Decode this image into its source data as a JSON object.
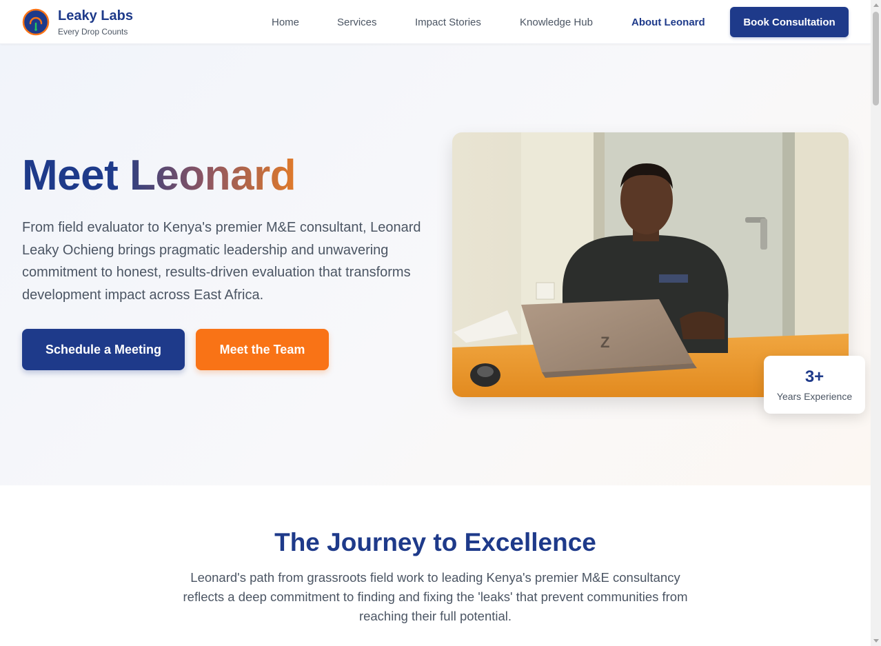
{
  "header": {
    "brand_name": "Leaky Labs",
    "brand_tagline": "Every Drop Counts",
    "nav": [
      {
        "label": "Home"
      },
      {
        "label": "Services"
      },
      {
        "label": "Impact Stories"
      },
      {
        "label": "Knowledge Hub"
      },
      {
        "label": "About Leonard",
        "active": true
      }
    ],
    "cta_label": "Book Consultation"
  },
  "hero": {
    "title_part1": "Meet",
    "title_part2": "Leonard",
    "description": "From field evaluator to Kenya's premier M&E consultant, Leonard Leaky Ochieng brings pragmatic leadership and unwavering commitment to honest, results-driven evaluation that transforms development impact across East Africa.",
    "primary_button": "Schedule a Meeting",
    "secondary_button": "Meet the Team",
    "stat_value": "3+",
    "stat_label": "Years Experience"
  },
  "journey": {
    "title": "The Journey to Excellence",
    "description": "Leonard's path from grassroots field work to leading Kenya's premier M&E consultancy reflects a deep commitment to finding and fixing the 'leaks' that prevent communities from reaching their full potential."
  },
  "colors": {
    "primary": "#1e3a8a",
    "accent": "#f97316",
    "text_muted": "#4b5563"
  },
  "icons": {
    "logo": "drop-logo-icon"
  }
}
